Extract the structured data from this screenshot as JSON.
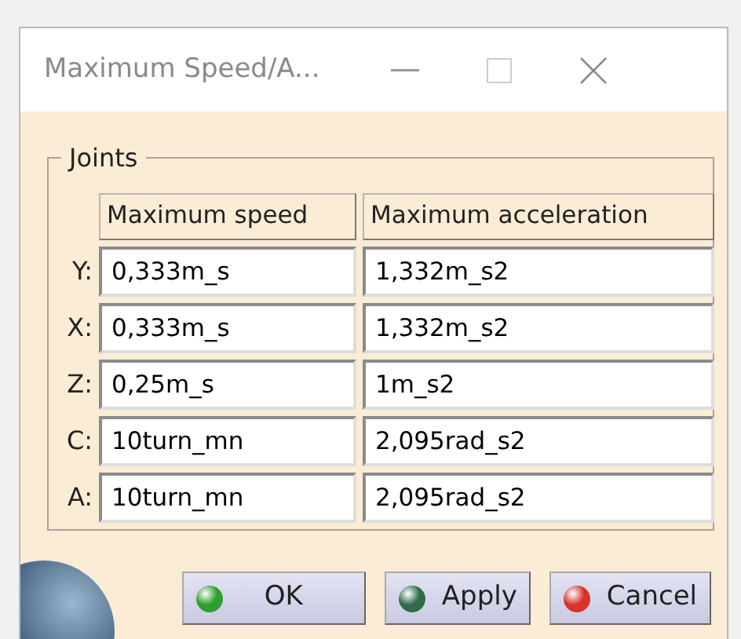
{
  "window": {
    "title": "Maximum Speed/A..."
  },
  "group": {
    "title": "Joints"
  },
  "table": {
    "columns": [
      "Maximum speed",
      "Maximum acceleration"
    ],
    "rows": [
      {
        "label": "Y:",
        "speed": "0,333m_s",
        "acceleration": "1,332m_s2"
      },
      {
        "label": "X:",
        "speed": "0,333m_s",
        "acceleration": "1,332m_s2"
      },
      {
        "label": "Z:",
        "speed": "0,25m_s",
        "acceleration": "1m_s2"
      },
      {
        "label": "C:",
        "speed": "10turn_mn",
        "acceleration": "2,095rad_s2"
      },
      {
        "label": "A:",
        "speed": "10turn_mn",
        "acceleration": "2,095rad_s2"
      }
    ]
  },
  "buttons": [
    {
      "label": "OK",
      "color": "#2e9e2e"
    },
    {
      "label": "Apply",
      "color": "#2f6a4a"
    },
    {
      "label": "Cancel",
      "color": "#d8322a"
    }
  ]
}
